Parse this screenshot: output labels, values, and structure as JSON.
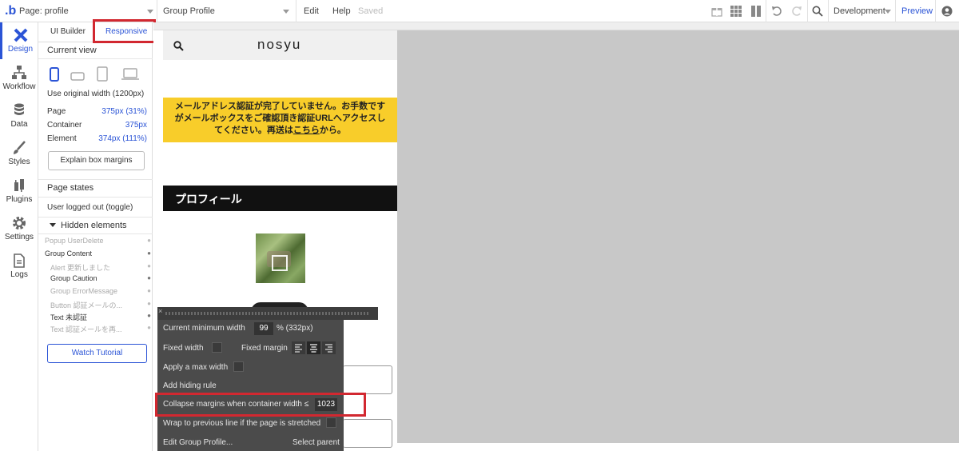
{
  "topbar": {
    "page_select": "Page: profile",
    "element_select": "Group Profile",
    "menu_edit": "Edit",
    "menu_help": "Help",
    "saved": "Saved",
    "environment": "Development",
    "preview": "Preview"
  },
  "rail": {
    "items": [
      {
        "label": "Design",
        "icon": "design-icon"
      },
      {
        "label": "Workflow",
        "icon": "workflow-icon"
      },
      {
        "label": "Data",
        "icon": "database-icon"
      },
      {
        "label": "Styles",
        "icon": "brush-icon"
      },
      {
        "label": "Plugins",
        "icon": "plug-icon"
      },
      {
        "label": "Settings",
        "icon": "gear-icon"
      },
      {
        "label": "Logs",
        "icon": "document-icon"
      }
    ]
  },
  "panel": {
    "tab_ui_builder": "UI Builder",
    "tab_responsive": "Responsive",
    "current_view": "Current view",
    "use_original_width": "Use original width (1200px)",
    "page_label": "Page",
    "page_value": "375px (31%)",
    "container_label": "Container",
    "container_value": "375px",
    "element_label": "Element",
    "element_value": "374px (111%)",
    "explain_button": "Explain box margins",
    "page_states": "Page states",
    "user_logged_out": "User logged out (toggle)",
    "hidden_elements": "Hidden elements",
    "hidden_list": [
      {
        "name": "Popup UserDelete"
      },
      {
        "name": "Group Content"
      },
      {
        "name": "Alert 更新しました"
      },
      {
        "name": "Group Caution"
      },
      {
        "name": "Group ErrorMessage"
      },
      {
        "name": "Button 認証メールの..."
      },
      {
        "name": "Text 未認証"
      },
      {
        "name": "Text 認証メールを再..."
      }
    ],
    "watch_tutorial": "Watch Tutorial"
  },
  "page_preview": {
    "logo": "nosyu",
    "notice_line1": "メールアドレス認証が完了していません。お手数です",
    "notice_line2": "がメールボックスをご確認頂き認証URLへアクセスし",
    "notice_line3_a": "てください。再送は",
    "notice_link": "こちら",
    "notice_line3_b": "から。",
    "profile_header": "プロフィール"
  },
  "popup": {
    "current_min_width_label": "Current minimum width",
    "current_min_width_value": "99",
    "current_min_width_suffix": "% (332px)",
    "fixed_width": "Fixed width",
    "fixed_margin": "Fixed margin",
    "apply_max_width": "Apply a max width",
    "add_hiding_rule": "Add hiding rule",
    "collapse_margins": "Collapse margins when container width ≤",
    "collapse_value": "1023",
    "wrap_previous": "Wrap to previous line if the page is stretched",
    "edit_group": "Edit Group Profile...",
    "select_parent": "Select parent"
  },
  "colors": {
    "accent": "#2b54d6",
    "highlight_red": "#d22830",
    "notice_yellow": "#f8cd2a"
  }
}
